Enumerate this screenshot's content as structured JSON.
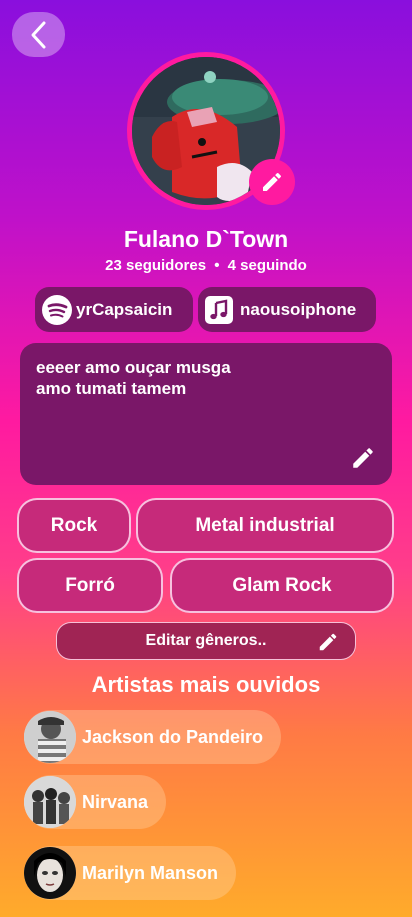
{
  "header": {
    "back_icon": "chevron-left-icon"
  },
  "profile": {
    "name": "Fulano D`Town",
    "followers": "23 seguidores",
    "separator": "•",
    "following": "4 seguindo",
    "accent": "#ff1aa0"
  },
  "links": [
    {
      "icon": "spotify-icon",
      "label": "yrCapsaicin"
    },
    {
      "icon": "music-note-icon",
      "label": "naousoiphone"
    }
  ],
  "bio": {
    "line1": "eeeer amo ouçar musga",
    "line2": "amo tumati tamem"
  },
  "genres": [
    "Rock",
    "Metal industrial",
    "Forró",
    "Glam Rock"
  ],
  "edit_genres_label": "Editar gêneros..",
  "top_artists": {
    "title": "Artistas mais ouvidos",
    "items": [
      {
        "name": "Jackson do Pandeiro"
      },
      {
        "name": "Nirvana"
      },
      {
        "name": "Marilyn Manson"
      }
    ]
  }
}
